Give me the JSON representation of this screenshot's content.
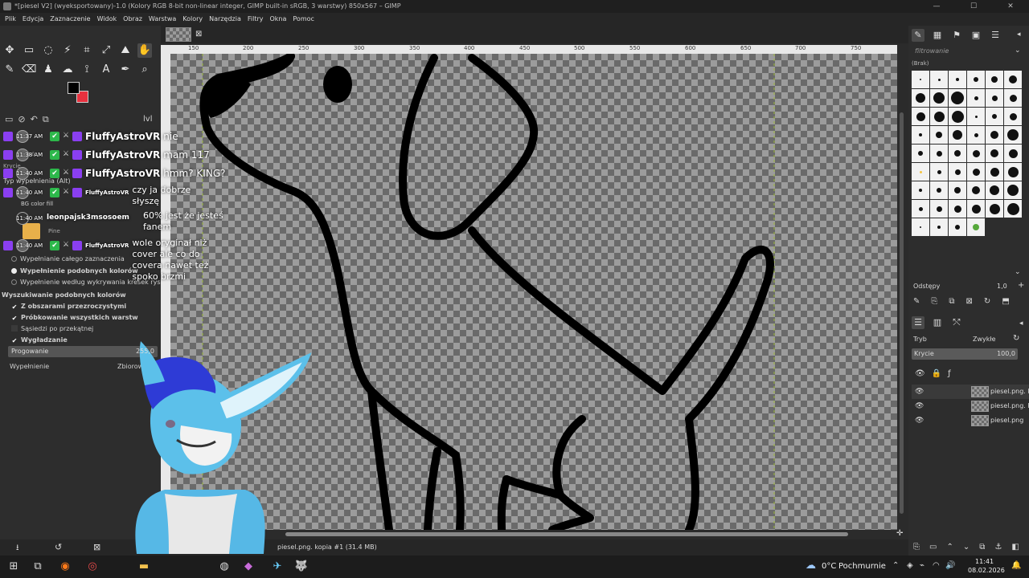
{
  "window": {
    "title": "*[piesel V2] (wyeksportowany)-1.0 (Kolory RGB 8-bit non-linear integer, GIMP built-in sRGB, 3 warstwy) 850x567 – GIMP"
  },
  "menu": [
    "Plik",
    "Edycja",
    "Zaznaczenie",
    "Widok",
    "Obraz",
    "Warstwa",
    "Kolory",
    "Narzędzia",
    "Filtry",
    "Okna",
    "Pomoc"
  ],
  "colors": {
    "foreground": "#000000",
    "background": "#e8313f",
    "twitch": "#8a3ff0"
  },
  "tool_options": {
    "items": [
      "Krycie",
      "Typ wypełnienia (Alt)",
      "BG color fill",
      "Wypełnianie całego zaznaczenia",
      "Wypełnienie podobnych kolorów",
      "Wypełnienie według wykrywania kresek rysunku",
      "Wyszukiwanie podobnych kolorów",
      "Z obszarami przezroczystymi",
      "Próbkowanie wszystkich warstw",
      "Sąsiedzi po przekątnej",
      "Wygładzanie"
    ],
    "threshold_label": "Progowanie",
    "threshold_value": "255,0",
    "threshold_fraction": 1.0,
    "fill_label": "Wypełnienie",
    "fill_value": "Zbiorow",
    "pattern_label": "Pine",
    "opacity_value": "100,0",
    "leftover": "lvl"
  },
  "chat": [
    {
      "time": "11:37 AM",
      "user": "FluffyAstroVR",
      "message": "nie"
    },
    {
      "time": "11:38 AM",
      "user": "FluffyAstroVR",
      "message": "mam 117"
    },
    {
      "time": "11:40 AM",
      "user": "FluffyAstroVR",
      "message": "hmm? KING?"
    },
    {
      "time": "11:40 AM",
      "user": "FluffyAstroVR",
      "message": "czy ja dobrze słyszę"
    },
    {
      "time": "11:40 AM",
      "user": "leonpajsk3msosoem",
      "message": "60% jest że jesteś fanem"
    },
    {
      "time": "11:40 AM",
      "user": "FluffyAstroVR",
      "message": "wole oryginał niż cover ale co do covera nawet też spoko brzmi"
    }
  ],
  "ruler_ticks": [
    "150",
    "200",
    "250",
    "300",
    "350",
    "400",
    "450",
    "500",
    "550",
    "600",
    "650",
    "700",
    "750",
    "800"
  ],
  "status": {
    "layer": "piesel.png. kopia #1 (31.4 MB)"
  },
  "brushes": {
    "filter_placeholder": "filtrowanie",
    "tag": "(Brak)",
    "spacing_label": "Odstępy",
    "spacing_value": "1,0"
  },
  "layers": {
    "mode_label": "Tryb",
    "mode_value": "Zwykłe",
    "opacity_label": "Krycie",
    "opacity_value": "100,0",
    "items": [
      "piesel.png. kopia",
      "piesel.png. kopia",
      "piesel.png"
    ]
  },
  "taskbar": {
    "weather_temp": "0°C",
    "weather_text": "Pochmurnie",
    "time": "11:41",
    "date": "08.02.2026"
  }
}
